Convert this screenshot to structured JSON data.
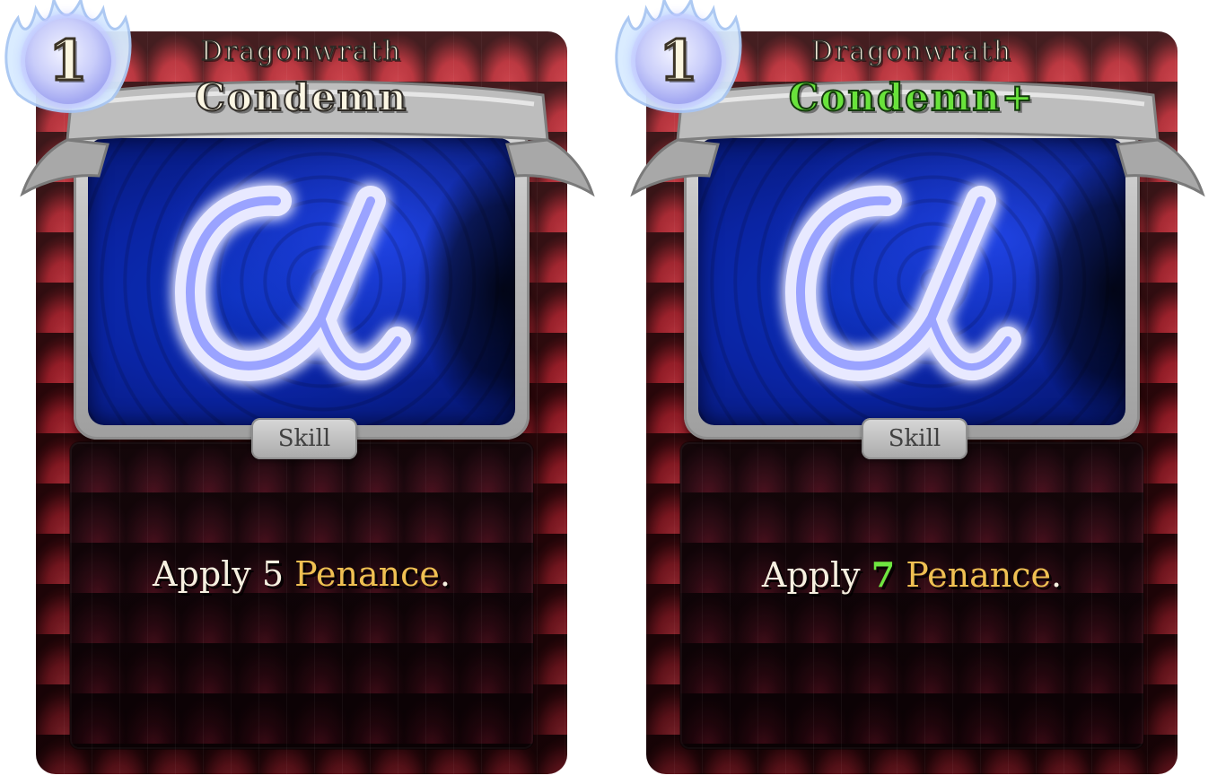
{
  "cards": [
    {
      "energy_cost": "1",
      "card_class": "Dragonwrath",
      "title": "Condemn",
      "type": "Skill",
      "art_symbol": "α",
      "description": {
        "prefix": "Apply ",
        "amount": "5",
        "space": " ",
        "keyword": "Penance",
        "suffix": "."
      },
      "upgraded": false
    },
    {
      "energy_cost": "1",
      "card_class": "Dragonwrath",
      "title": "Condemn+",
      "type": "Skill",
      "art_symbol": "α",
      "description": {
        "prefix": "Apply ",
        "amount": "7",
        "space": " ",
        "keyword": "Penance",
        "suffix": "."
      },
      "upgraded": true
    }
  ],
  "colors": {
    "card_red": "#8e1a24",
    "panel_dark": "#2b060e",
    "frame_silver": "#b6b6b6",
    "art_blue": "#0a24a3",
    "energy_orb": "#c9cdfa",
    "title_text": "#fbf6e3",
    "upgraded_green": "#69e33b",
    "keyword_gold": "#efc052"
  },
  "icons": {
    "energy": "energy-flame-icon",
    "art": "alpha-symbol-art"
  }
}
